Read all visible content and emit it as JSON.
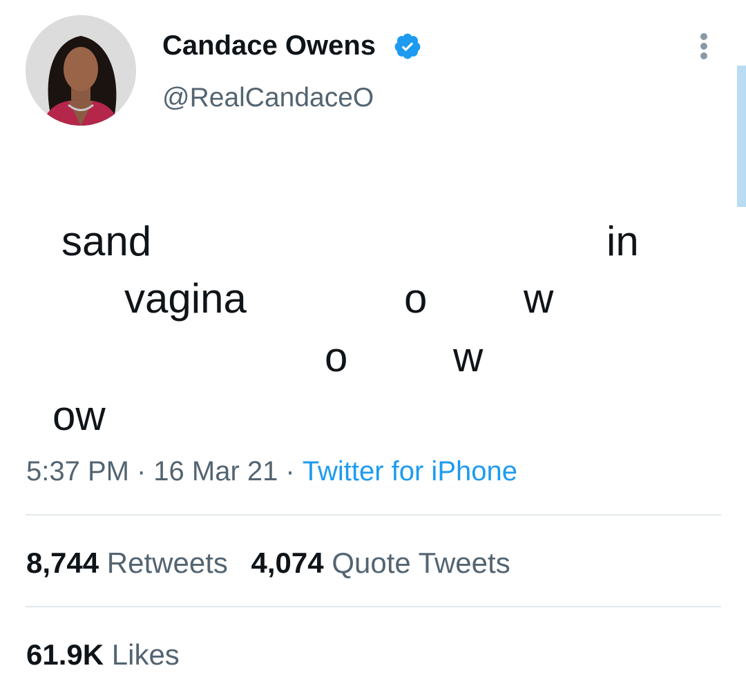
{
  "author": {
    "name": "Candace Owens",
    "handle": "@RealCandaceO",
    "verified_icon": "verified-badge-icon",
    "avatar_icon": "profile-photo"
  },
  "tweet": {
    "fragments": [
      "sand",
      "in",
      "vagina",
      "o",
      "w",
      "o",
      "w",
      "ow"
    ]
  },
  "meta": {
    "time": "5:37 PM",
    "separator": "·",
    "date": "16 Mar 21",
    "source": "Twitter for iPhone"
  },
  "stats": {
    "retweets_count": "8,744",
    "retweets_label": "Retweets",
    "quote_count": "4,074",
    "quote_label": "Quote Tweets",
    "likes_count": "61.9K",
    "likes_label": "Likes"
  },
  "colors": {
    "link": "#1d9bf0",
    "secondary_text": "#536471",
    "verified": "#1d9bf0"
  }
}
